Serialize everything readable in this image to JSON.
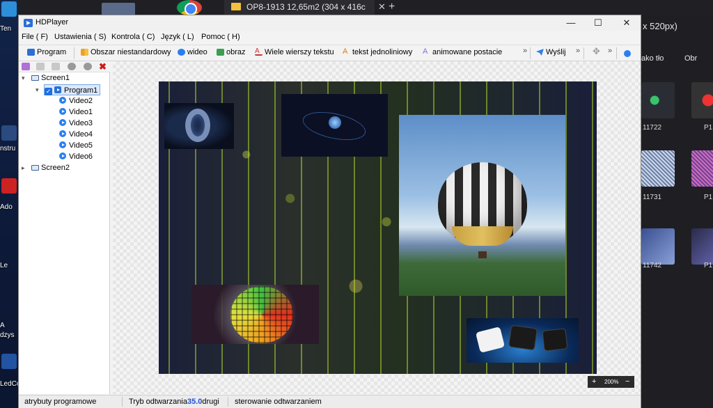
{
  "desktop": {
    "icons": [
      {
        "label": "Ten"
      },
      {
        "label": "nstru"
      },
      {
        "label": "Ado"
      },
      {
        "label": "Le"
      },
      {
        "label": "A"
      },
      {
        "label": "dzys"
      },
      {
        "label": "LedCo"
      }
    ]
  },
  "browser": {
    "tab_title": "OP8-1913 12,65m2 (304 x 416c",
    "tab_close": "✕",
    "new_tab": "+"
  },
  "right_app": {
    "header_text": "x 520px)",
    "tool_labels": [
      "ako tło",
      "Obr"
    ],
    "thumbnails": [
      {
        "label": "11722"
      },
      {
        "label": "P1"
      },
      {
        "label": "11731"
      },
      {
        "label": "P1"
      },
      {
        "label": "11742"
      },
      {
        "label": "P1"
      }
    ]
  },
  "window": {
    "title": "HDPlayer",
    "controls": {
      "minimize": "—",
      "maximize": "☐",
      "close": "✕"
    }
  },
  "menu": [
    "File ( F)",
    "Ustawienia ( S)",
    "Kontrola ( C)",
    "Język ( L)",
    "Pomoc ( H)"
  ],
  "toolbar": {
    "items": [
      {
        "label": "Program",
        "icon": "program-icon",
        "color": "#2a6fd6"
      },
      {
        "label": "Obszar niestandardowy",
        "icon": "grid-area-icon",
        "color": "#f0a020"
      },
      {
        "label": "wideo",
        "icon": "video-icon",
        "color": "#2a7ff0"
      },
      {
        "label": "obraz",
        "icon": "image-icon",
        "color": "#3aa050"
      },
      {
        "label": "Wiele wierszy tekstu",
        "icon": "multiline-text-icon",
        "color": "#d23030"
      },
      {
        "label": "tekst jednoliniowy",
        "icon": "single-line-text-icon",
        "color": "#e07a10"
      },
      {
        "label": "animowane postacie",
        "icon": "animated-text-icon",
        "color": "#8a6ad8"
      },
      {
        "label": "Wyślij",
        "icon": "send-icon",
        "color": "#2a7ff0"
      }
    ],
    "chevron": "»"
  },
  "tree": {
    "screens": [
      {
        "label": "Screen1",
        "programs": [
          {
            "label": "Program1",
            "videos": [
              "Video2",
              "Video1",
              "Video3",
              "Video4",
              "Video5",
              "Video6"
            ]
          }
        ]
      },
      {
        "label": "Screen2",
        "programs": []
      }
    ]
  },
  "canvas": {
    "zoom": "200%",
    "zoom_in": "+",
    "zoom_out": "−"
  },
  "status": {
    "program_attributes": "atrybuty programowe",
    "playback_mode_label": "Tryb odtwarzania",
    "playback_value": "35.0",
    "playback_unit": "drugi",
    "playback_control": "sterowanie odtwarzaniem"
  }
}
